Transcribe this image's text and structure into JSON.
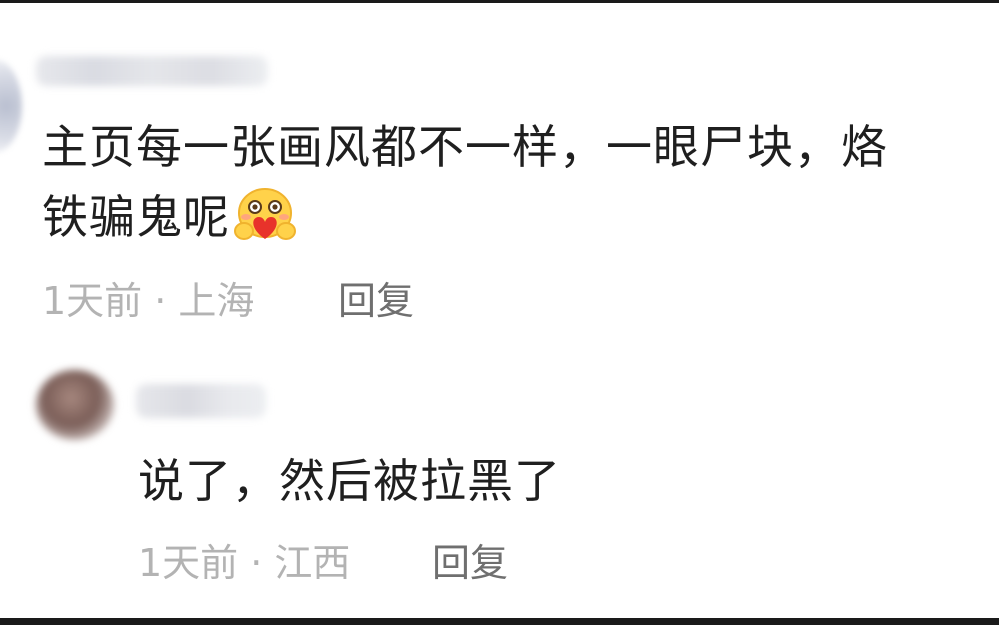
{
  "comments": [
    {
      "text_line1": "主页每一张画风都不一样，一眼尸块，烙",
      "text_line2": "铁骗鬼呢",
      "emoji": "hug-heart-emoji",
      "meta": "1天前 · 上海",
      "reply_label": "回复"
    },
    {
      "text": "说了，然后被拉黑了",
      "meta": "1天前 · 江西",
      "reply_label": "回复"
    }
  ],
  "colors": {
    "text": "#1f1f1f",
    "meta": "#b3b3b3",
    "reply": "#6f6f6f",
    "emoji_face": "#ffd24a",
    "emoji_heart": "#e8322b"
  }
}
